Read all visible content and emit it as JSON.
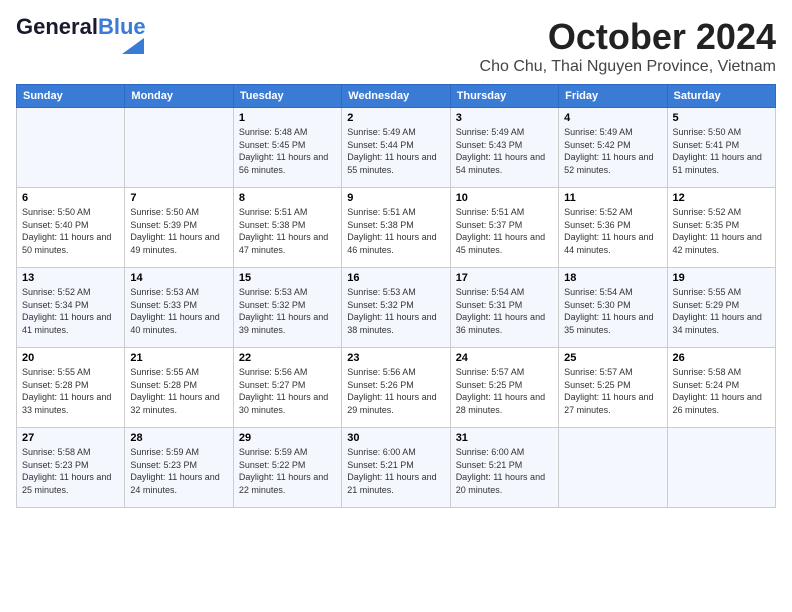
{
  "logo": {
    "text_general": "General",
    "text_blue": "Blue"
  },
  "title": "October 2024",
  "location": "Cho Chu, Thai Nguyen Province, Vietnam",
  "days_header": [
    "Sunday",
    "Monday",
    "Tuesday",
    "Wednesday",
    "Thursday",
    "Friday",
    "Saturday"
  ],
  "weeks": [
    [
      {
        "day": "",
        "info": ""
      },
      {
        "day": "",
        "info": ""
      },
      {
        "day": "1",
        "info": "Sunrise: 5:48 AM\nSunset: 5:45 PM\nDaylight: 11 hours and 56 minutes."
      },
      {
        "day": "2",
        "info": "Sunrise: 5:49 AM\nSunset: 5:44 PM\nDaylight: 11 hours and 55 minutes."
      },
      {
        "day": "3",
        "info": "Sunrise: 5:49 AM\nSunset: 5:43 PM\nDaylight: 11 hours and 54 minutes."
      },
      {
        "day": "4",
        "info": "Sunrise: 5:49 AM\nSunset: 5:42 PM\nDaylight: 11 hours and 52 minutes."
      },
      {
        "day": "5",
        "info": "Sunrise: 5:50 AM\nSunset: 5:41 PM\nDaylight: 11 hours and 51 minutes."
      }
    ],
    [
      {
        "day": "6",
        "info": "Sunrise: 5:50 AM\nSunset: 5:40 PM\nDaylight: 11 hours and 50 minutes."
      },
      {
        "day": "7",
        "info": "Sunrise: 5:50 AM\nSunset: 5:39 PM\nDaylight: 11 hours and 49 minutes."
      },
      {
        "day": "8",
        "info": "Sunrise: 5:51 AM\nSunset: 5:38 PM\nDaylight: 11 hours and 47 minutes."
      },
      {
        "day": "9",
        "info": "Sunrise: 5:51 AM\nSunset: 5:38 PM\nDaylight: 11 hours and 46 minutes."
      },
      {
        "day": "10",
        "info": "Sunrise: 5:51 AM\nSunset: 5:37 PM\nDaylight: 11 hours and 45 minutes."
      },
      {
        "day": "11",
        "info": "Sunrise: 5:52 AM\nSunset: 5:36 PM\nDaylight: 11 hours and 44 minutes."
      },
      {
        "day": "12",
        "info": "Sunrise: 5:52 AM\nSunset: 5:35 PM\nDaylight: 11 hours and 42 minutes."
      }
    ],
    [
      {
        "day": "13",
        "info": "Sunrise: 5:52 AM\nSunset: 5:34 PM\nDaylight: 11 hours and 41 minutes."
      },
      {
        "day": "14",
        "info": "Sunrise: 5:53 AM\nSunset: 5:33 PM\nDaylight: 11 hours and 40 minutes."
      },
      {
        "day": "15",
        "info": "Sunrise: 5:53 AM\nSunset: 5:32 PM\nDaylight: 11 hours and 39 minutes."
      },
      {
        "day": "16",
        "info": "Sunrise: 5:53 AM\nSunset: 5:32 PM\nDaylight: 11 hours and 38 minutes."
      },
      {
        "day": "17",
        "info": "Sunrise: 5:54 AM\nSunset: 5:31 PM\nDaylight: 11 hours and 36 minutes."
      },
      {
        "day": "18",
        "info": "Sunrise: 5:54 AM\nSunset: 5:30 PM\nDaylight: 11 hours and 35 minutes."
      },
      {
        "day": "19",
        "info": "Sunrise: 5:55 AM\nSunset: 5:29 PM\nDaylight: 11 hours and 34 minutes."
      }
    ],
    [
      {
        "day": "20",
        "info": "Sunrise: 5:55 AM\nSunset: 5:28 PM\nDaylight: 11 hours and 33 minutes."
      },
      {
        "day": "21",
        "info": "Sunrise: 5:55 AM\nSunset: 5:28 PM\nDaylight: 11 hours and 32 minutes."
      },
      {
        "day": "22",
        "info": "Sunrise: 5:56 AM\nSunset: 5:27 PM\nDaylight: 11 hours and 30 minutes."
      },
      {
        "day": "23",
        "info": "Sunrise: 5:56 AM\nSunset: 5:26 PM\nDaylight: 11 hours and 29 minutes."
      },
      {
        "day": "24",
        "info": "Sunrise: 5:57 AM\nSunset: 5:25 PM\nDaylight: 11 hours and 28 minutes."
      },
      {
        "day": "25",
        "info": "Sunrise: 5:57 AM\nSunset: 5:25 PM\nDaylight: 11 hours and 27 minutes."
      },
      {
        "day": "26",
        "info": "Sunrise: 5:58 AM\nSunset: 5:24 PM\nDaylight: 11 hours and 26 minutes."
      }
    ],
    [
      {
        "day": "27",
        "info": "Sunrise: 5:58 AM\nSunset: 5:23 PM\nDaylight: 11 hours and 25 minutes."
      },
      {
        "day": "28",
        "info": "Sunrise: 5:59 AM\nSunset: 5:23 PM\nDaylight: 11 hours and 24 minutes."
      },
      {
        "day": "29",
        "info": "Sunrise: 5:59 AM\nSunset: 5:22 PM\nDaylight: 11 hours and 22 minutes."
      },
      {
        "day": "30",
        "info": "Sunrise: 6:00 AM\nSunset: 5:21 PM\nDaylight: 11 hours and 21 minutes."
      },
      {
        "day": "31",
        "info": "Sunrise: 6:00 AM\nSunset: 5:21 PM\nDaylight: 11 hours and 20 minutes."
      },
      {
        "day": "",
        "info": ""
      },
      {
        "day": "",
        "info": ""
      }
    ]
  ]
}
